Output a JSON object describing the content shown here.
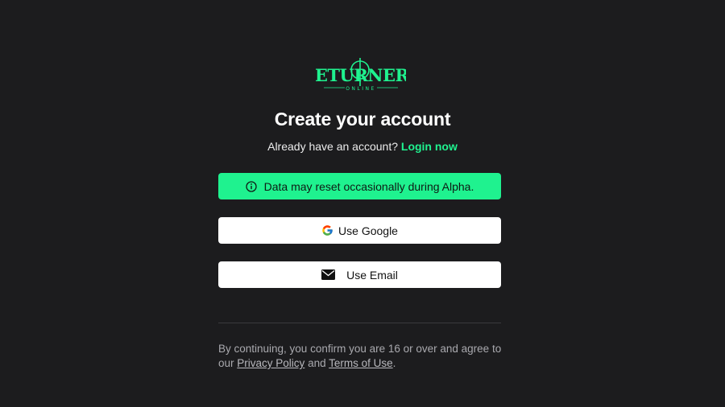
{
  "logo": {
    "wordmark": "RETURNERS",
    "subword": "ONLINE",
    "color": "#1ff28f"
  },
  "title": "Create your account",
  "subtitle": {
    "text": "Already have an account?",
    "login_link": "Login now"
  },
  "notice": {
    "icon": "info-icon",
    "text": "Data may reset occasionally during Alpha.",
    "color": "#1ff28f"
  },
  "buttons": {
    "google": {
      "icon": "google-icon",
      "label": "Use Google"
    },
    "email": {
      "icon": "mail-icon",
      "label": "Use Email"
    }
  },
  "legal": {
    "text_before": "By continuing, you confirm you are 16 or over and agree to our",
    "privacy_link": "Privacy Policy",
    "and": "and",
    "terms_link": "Terms of Use",
    "period": "."
  },
  "colors": {
    "background": "#1c1c1e",
    "accent": "#1ff28f"
  }
}
